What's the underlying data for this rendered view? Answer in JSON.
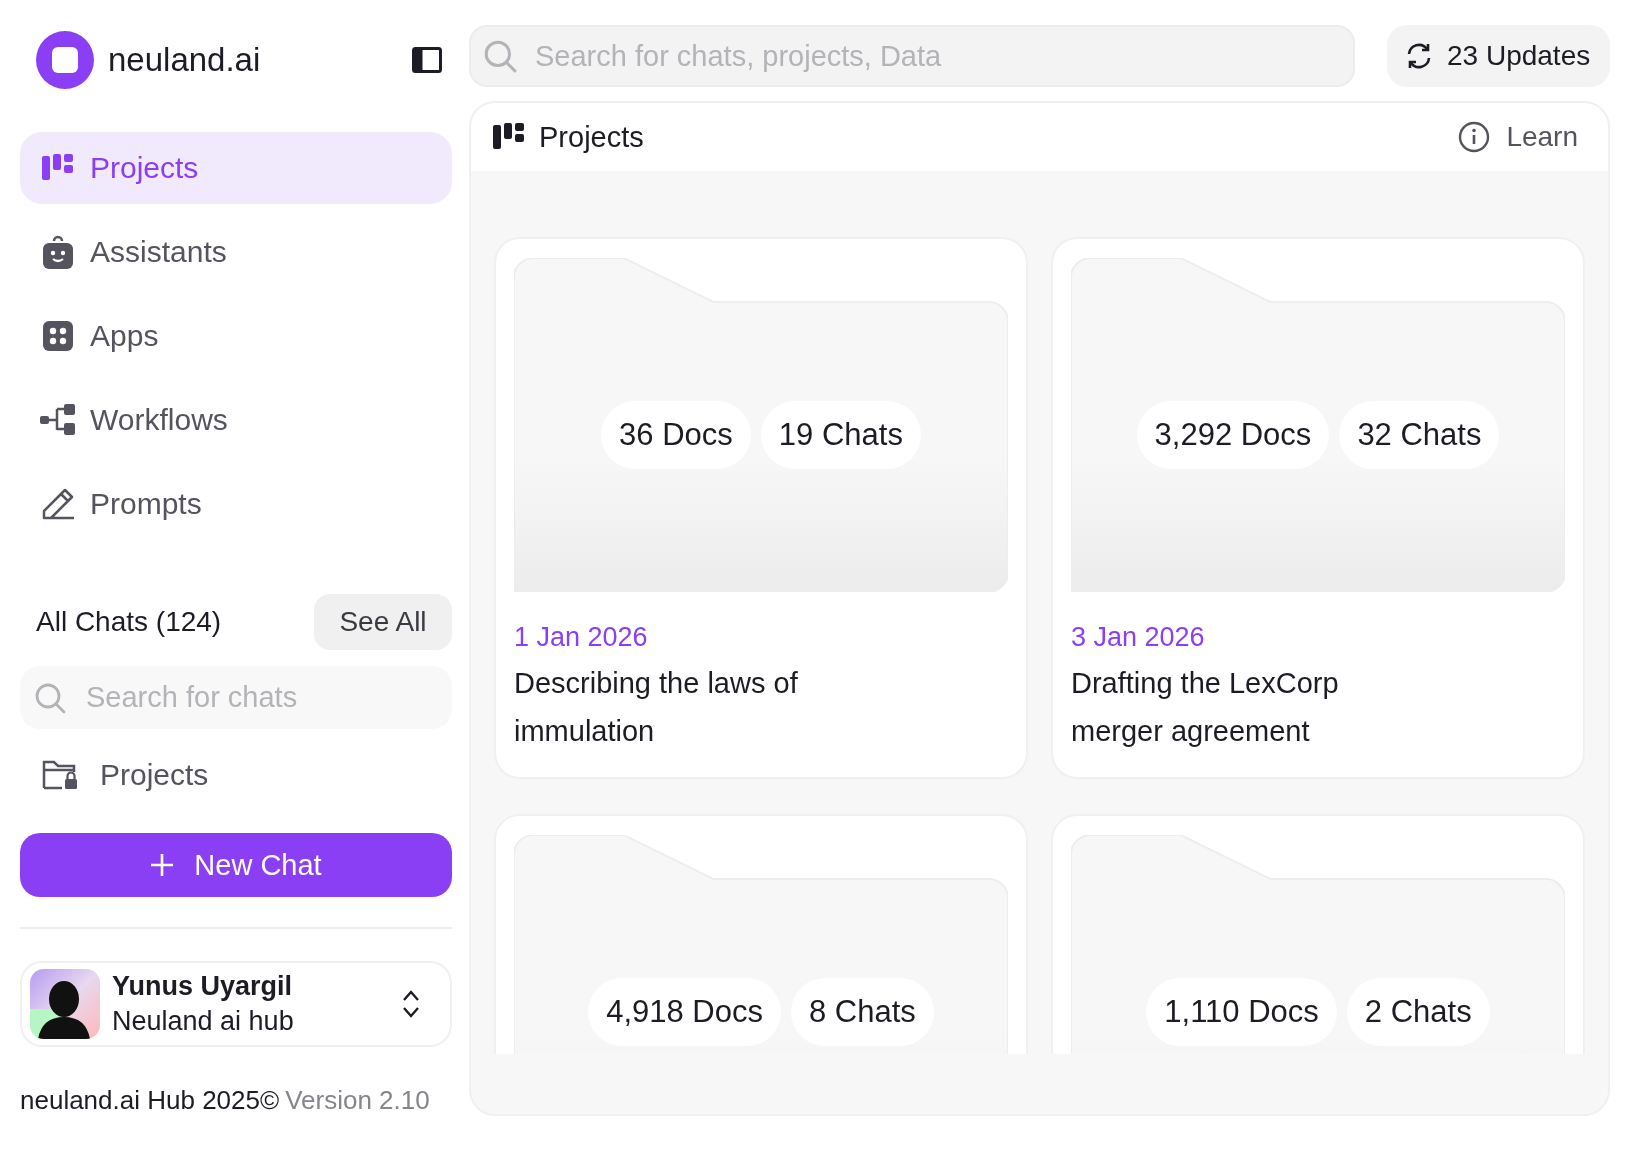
{
  "brand": {
    "name": "neuland.ai"
  },
  "nav": [
    {
      "label": "Projects",
      "kind": "projects",
      "selected": true
    },
    {
      "label": "Assistants",
      "kind": "assistants",
      "selected": false
    },
    {
      "label": "Apps",
      "kind": "apps",
      "selected": false
    },
    {
      "label": "Workflows",
      "kind": "workflows",
      "selected": false
    },
    {
      "label": "Prompts",
      "kind": "prompts",
      "selected": false
    }
  ],
  "chats": {
    "title": "All Chats (124)",
    "see_all": "See All",
    "search": {
      "placeholder": "Search for chats"
    },
    "folder": "Projects"
  },
  "new_chat": "New Chat",
  "user": {
    "name": "Yunus Uyargil",
    "org": "Neuland ai hub"
  },
  "footer": {
    "copyright": "neuland.ai Hub 2025©",
    "version": "Version 2.10"
  },
  "search": {
    "placeholder": "Search for chats, projects, Data"
  },
  "updates": "23 Updates",
  "panel": {
    "title": "Projects",
    "learn": "Learn"
  },
  "projects": [
    {
      "docs": "36 Docs",
      "chats": "19 Chats",
      "date": "1 Jan 2026",
      "title": "Describing the laws of immulation"
    },
    {
      "docs": "3,292 Docs",
      "chats": "32 Chats",
      "date": "3 Jan 2026",
      "title": "Drafting the LexCorp merger agreement"
    },
    {
      "docs": "4,918 Docs",
      "chats": "8 Chats"
    },
    {
      "docs": "1,110 Docs",
      "chats": "2 Chats"
    }
  ]
}
